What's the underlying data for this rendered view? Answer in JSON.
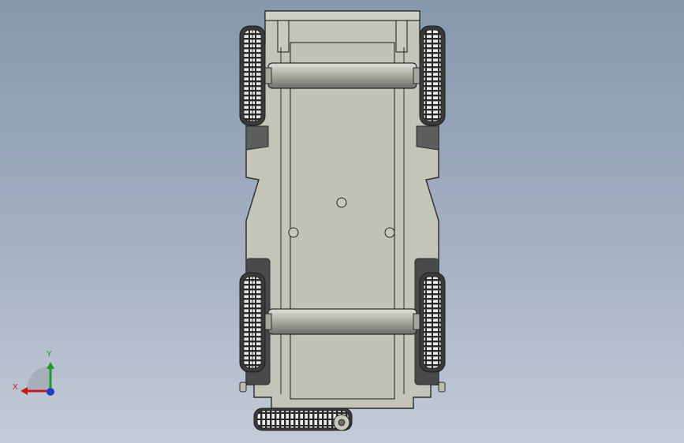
{
  "viewport": {
    "background_top": "#8797ac",
    "background_bottom": "#c3cbd6"
  },
  "model": {
    "name": "vehicle-chassis-bottom-view",
    "body_color": "#c4c4b8",
    "edge_color": "#2b2b2b",
    "tire_color": "#3a3a3a",
    "axle_color": "#8f8f86"
  },
  "triad": {
    "x_label": "X",
    "y_label": "Y",
    "x_color": "#c21a1a",
    "y_color": "#1c9c2c",
    "z_color": "#1f3fbf"
  }
}
